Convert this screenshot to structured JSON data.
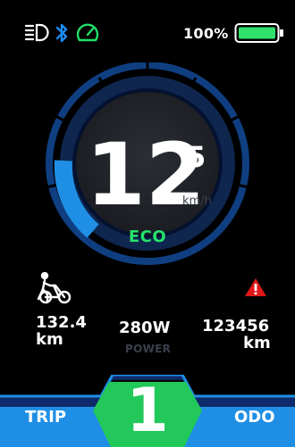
{
  "status": {
    "icons": [
      "headlight-icon",
      "bluetooth-icon",
      "speedometer-icon"
    ],
    "battery_percent": "100%",
    "battery_level": 1.0,
    "colors": {
      "bluetooth": "#1d8bf0",
      "speedo": "#20e06a",
      "battery": "#2fe06a"
    }
  },
  "speed": {
    "integer": "12",
    "decimal": "5",
    "unit": "km/h"
  },
  "assist_mode": "ECO",
  "stats": {
    "trip_distance": {
      "value": "132.4",
      "unit": "km"
    },
    "power": {
      "value": "280W",
      "label": "POWER"
    },
    "odo_distance": {
      "value": "123456",
      "unit": "km"
    }
  },
  "indicators": {
    "walk_assist": "walk-assist-icon",
    "warning": "warning-icon"
  },
  "footer": {
    "trip_label": "TRIP",
    "odo_label": "ODO",
    "gear": "1"
  },
  "colors": {
    "accent_blue": "#1f8fe6",
    "gear_green": "#22c85a",
    "background": "#000000"
  }
}
